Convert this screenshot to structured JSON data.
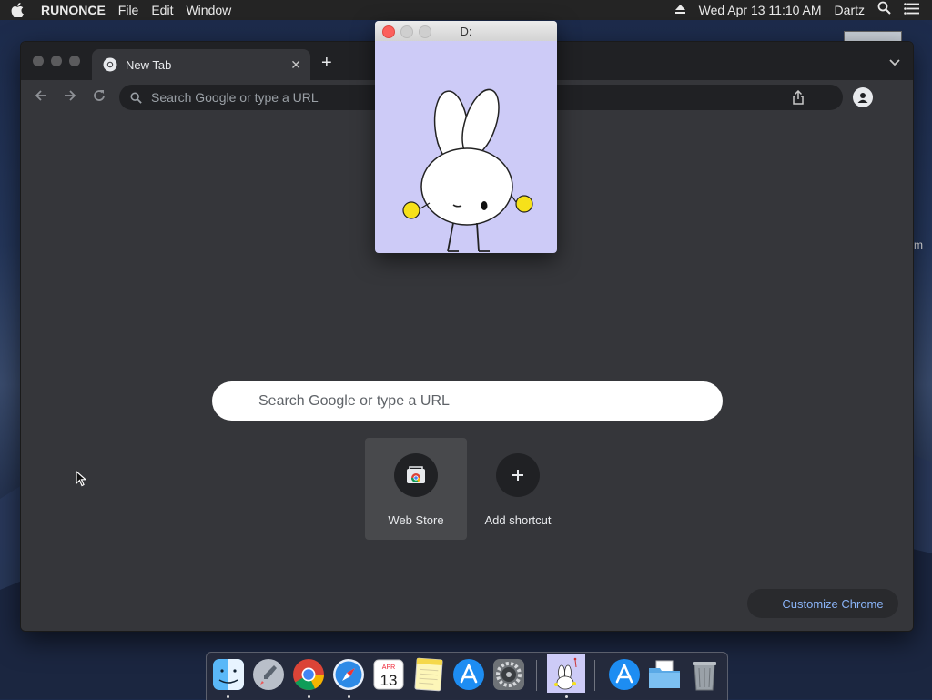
{
  "menubar": {
    "app_name": "RUNONCE",
    "menus": [
      "File",
      "Edit",
      "Window"
    ],
    "datetime": "Wed Apr 13  11:10 AM",
    "user": "Dartz"
  },
  "chrome": {
    "tab_title": "New Tab",
    "omnibox_placeholder": "Search Google or type a URL",
    "search_placeholder": "Search Google or type a URL",
    "shortcuts": [
      {
        "label": "Web Store",
        "icon": "web-store-icon"
      },
      {
        "label": "Add shortcut",
        "icon": "plus-icon"
      }
    ],
    "customize_label": "Customize Chrome"
  },
  "bunny_window": {
    "title": "D:",
    "background": "#cdcbf7"
  },
  "dock": {
    "calendar_month": "APR",
    "calendar_day": "13",
    "apps": [
      "Finder",
      "Launchpad",
      "Google Chrome",
      "Safari",
      "Calendar",
      "Notes",
      "App Store",
      "System Preferences",
      "Bunny",
      "App Store",
      "Downloads",
      "Trash"
    ]
  },
  "desktop": {
    "edge_text": "m"
  },
  "colors": {
    "chrome_bg": "#35363a",
    "tabstrip": "#202124",
    "link_blue": "#8ab4f8",
    "close_red": "#fc605c"
  }
}
